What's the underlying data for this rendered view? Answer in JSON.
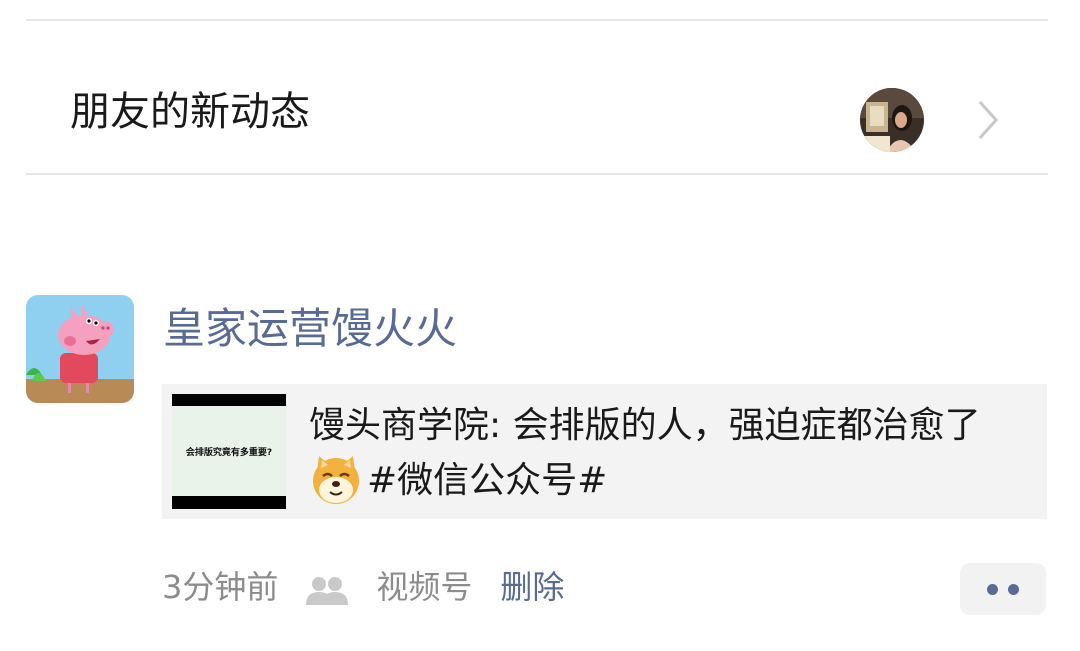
{
  "new_activity": {
    "title": "朋友的新动态"
  },
  "post": {
    "author": "皇家运营馒火火",
    "share": {
      "thumbnail_caption": "会排版究竟有多重要?",
      "text": "馒头商学院: 会排版的人，强迫症都治愈了",
      "hashtag": "#微信公众号#",
      "emoji": "doge-emoji"
    },
    "meta": {
      "time": "3分钟前",
      "visibility_icon": "users-icon",
      "channel": "视频号",
      "delete_label": "删除"
    },
    "more_icon": "more-dots-icon"
  },
  "colors": {
    "link": "#576b95",
    "meta_gray": "#8c8c8c",
    "card_bg": "#f3f3f3"
  }
}
